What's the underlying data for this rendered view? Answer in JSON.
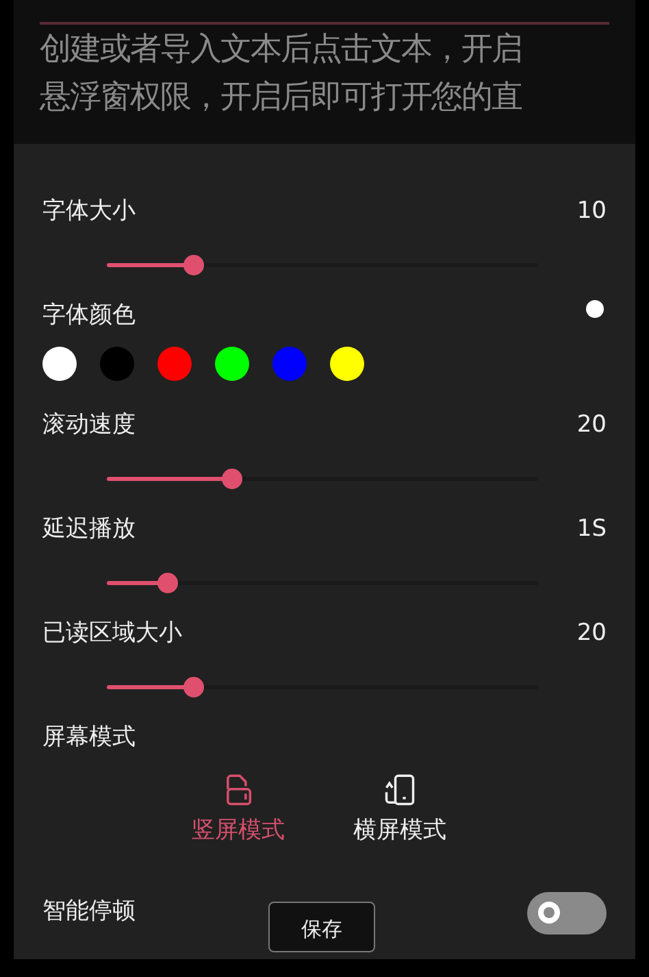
{
  "background_text": [
    "创建或者导入文本后点击文本，开启",
    "悬浮窗权限，开启后即可打开您的直"
  ],
  "settings": [
    {
      "kind": "slider",
      "label": "字体大小",
      "reading": "10",
      "level": 0.2
    },
    {
      "kind": "colors",
      "label": "字体颜色",
      "preview_dot": {
        "color": "#ffffff"
      },
      "colors": [
        {
          "color": "#ffffff"
        },
        {
          "color": "#000000"
        },
        {
          "color": "#ff0000"
        },
        {
          "color": "#00ff00"
        },
        {
          "color": "#0000ff"
        },
        {
          "color": "#ffff00"
        }
      ]
    },
    {
      "kind": "slider",
      "label": "滚动速度",
      "reading": "20",
      "level": 0.29
    },
    {
      "kind": "slider",
      "label": "延迟播放",
      "reading": "1S",
      "level": 0.14
    },
    {
      "kind": "slider",
      "label": "已读区域大小",
      "reading": "20",
      "level": 0.2
    },
    {
      "kind": "modes",
      "label": "屏幕模式",
      "modes": [
        {
          "label": "竖屏模式",
          "selected": true
        },
        {
          "label": "横屏模式",
          "selected": false
        }
      ]
    },
    {
      "kind": "toggle",
      "label": "智能停顿",
      "on": false
    }
  ],
  "save_button": "保存"
}
